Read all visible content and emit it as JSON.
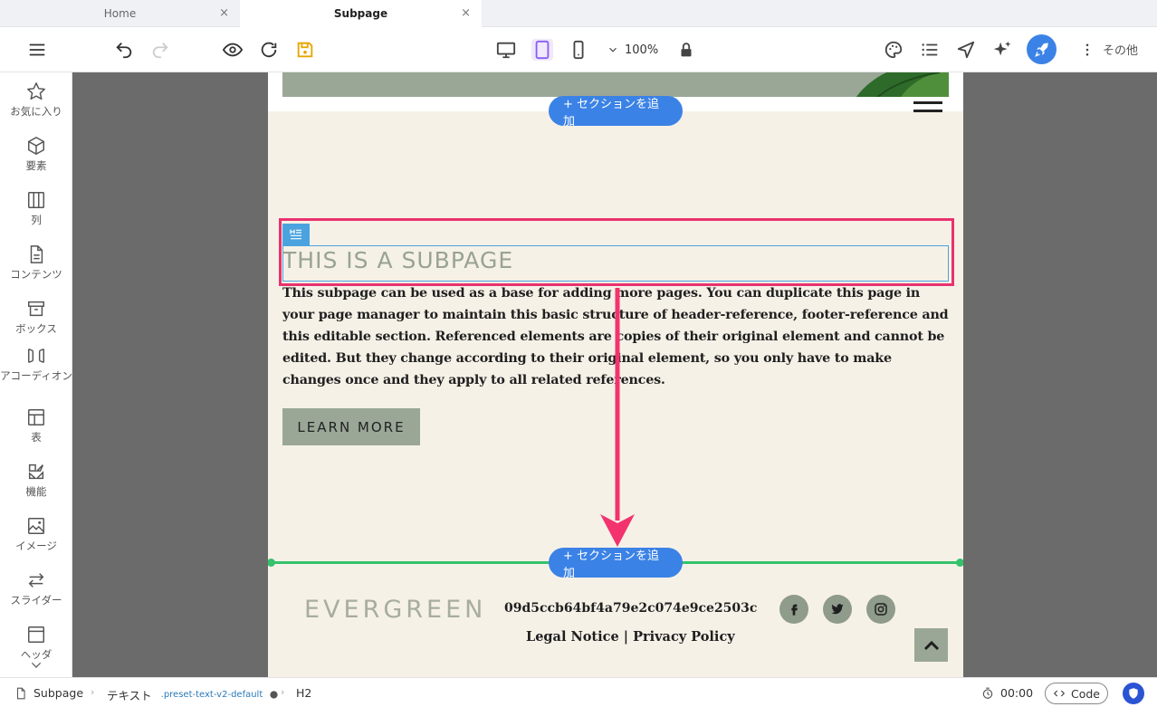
{
  "tabs": [
    {
      "label": "Home",
      "close": "×"
    },
    {
      "label": "Subpage",
      "close": "×"
    }
  ],
  "toolbar": {
    "zoom": "100%",
    "more_label": "その他"
  },
  "sidebar": {
    "items": [
      {
        "label": "お気に入り",
        "icon": "star-icon"
      },
      {
        "label": "要素",
        "icon": "cube-icon"
      },
      {
        "label": "列",
        "icon": "columns-icon"
      },
      {
        "label": "コンテンツ",
        "icon": "document-icon"
      },
      {
        "label": "ボックス",
        "icon": "box-icon"
      },
      {
        "label": "アコーディオン",
        "icon": "accordion-icon"
      },
      {
        "label": "表",
        "icon": "table-icon"
      },
      {
        "label": "機能",
        "icon": "features-icon"
      },
      {
        "label": "イメージ",
        "icon": "image-icon"
      },
      {
        "label": "スライダー",
        "icon": "slider-icon"
      },
      {
        "label": "ヘッダ",
        "icon": "header-icon"
      }
    ]
  },
  "canvas": {
    "add_section_label": "+ セクションを追加",
    "heading": "THIS IS A SUBPAGE",
    "body": "This subpage can be used as a base for adding more pages. You can duplicate this page in your page manager to maintain this basic structure of header-reference, footer-reference and this editable section. Referenced elements are copies of their original element and cannot be edited. But they change according to their original element, so you only have to make changes once and they apply to all related references.",
    "button": "LEARN MORE",
    "footer": {
      "logo": "EVERGREEN",
      "hash": "09d5ccb64bf4a79e2c074e9ce2503c",
      "legal": "Legal Notice | Privacy Policy"
    }
  },
  "bottombar": {
    "page": "Subpage",
    "element": "テキスト",
    "preset": ".preset-text-v2-default",
    "tag": "H2",
    "time": "00:00",
    "code": "Code"
  },
  "colors": {
    "accent_blue": "#3b82e6",
    "selection_pink": "#e8336d",
    "section_green": "#34c26b",
    "page_bg": "#f6f1e7",
    "sage": "#9aa797"
  }
}
